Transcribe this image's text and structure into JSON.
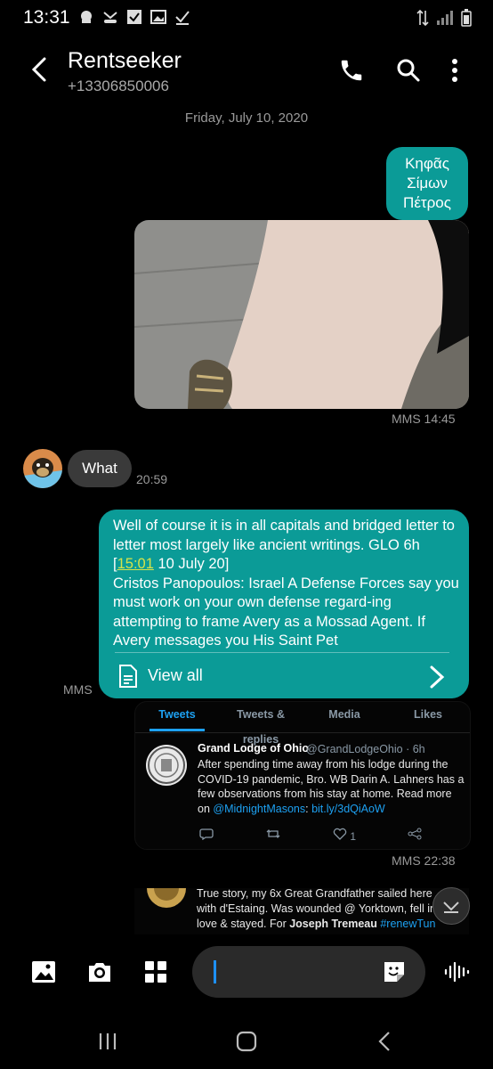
{
  "status_bar": {
    "time": "13:31"
  },
  "header": {
    "contact_name": "Rentseeker",
    "contact_number": "+13306850006"
  },
  "date_separator": "Friday, July 10, 2020",
  "messages": {
    "greek_text": "Κηφᾶς\nΣίμων\nΠέτρος",
    "photo_meta": "MMS 14:45",
    "incoming_text": "What",
    "incoming_time": "20:59",
    "long_text_1": "Well of course it is in all capitals and bridged letter to letter most largely like ancient writings.",
    "long_glo": "GLO 6h [",
    "long_ts": "15:01",
    "long_glo_end": " 10 July 20]",
    "long_text_2": "Cristos Panopoulos: Israel A Defense Forces say you must work on your own defense regard-ing attempting to frame Avery as a Mossad Agent. If Avery messages you His Saint Pet",
    "view_all": "View all",
    "long_meta": "MMS",
    "tweet_meta": "MMS 22:38"
  },
  "tweet": {
    "tabs": [
      "Tweets",
      "Tweets & replies",
      "Media",
      "Likes"
    ],
    "name": "Grand Lodge of Ohio",
    "handle": "@GrandLodgeOhio · 6h",
    "body_1": "After spending time away from his lodge during the COVID-19 pandemic, Bro. WB Darin A. Lahners has a few observations from his stay at home. Read more on ",
    "body_link_1": "@MidnightMasons",
    "body_colon": ": ",
    "body_link_2": "bit.ly/3dQiAoW",
    "likes": "1"
  },
  "tweet2": {
    "line_1": "True story, my 6x Great Grandfather sailed here",
    "line_2": "with d'Estaing. Was wounded @ Yorktown, fell in",
    "line_3_a": "love & stayed. For ",
    "line_3_b": "Joseph Tremeau",
    "line_3_c": " #renewTun"
  },
  "colors": {
    "accent": "#0b9b97",
    "link": "#1da1f2",
    "incoming": "#3a3a3a"
  }
}
